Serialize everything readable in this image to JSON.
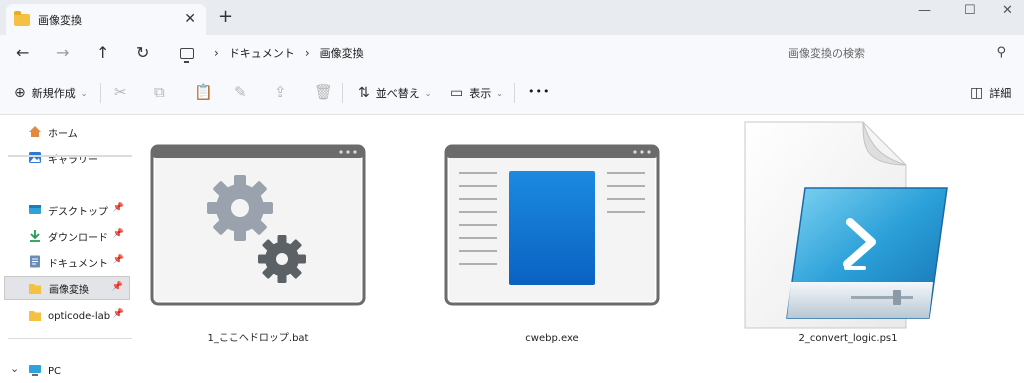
{
  "tab": {
    "title": "画像変換",
    "close": "✕",
    "new": "+"
  },
  "window": {
    "minimize": "—",
    "maximize": "☐",
    "close": "✕"
  },
  "nav": {
    "back": "←",
    "forward": "→",
    "up": "↑",
    "refresh": "↻",
    "breadcrumb": [
      "ドキュメント",
      "画像変換"
    ],
    "separator": "›",
    "search_placeholder": "画像変換の検索"
  },
  "toolbar": {
    "new_label": "新規作成",
    "sort_label": "並べ替え",
    "view_label": "表示",
    "more": "•••",
    "details_label": "詳細"
  },
  "sidebar": {
    "items": [
      {
        "label": "ホーム",
        "icon": "home-icon",
        "pinned": false
      },
      {
        "label": "ギャラリー",
        "icon": "gallery-icon",
        "pinned": false
      },
      {
        "label": "デスクトップ",
        "icon": "desktop-icon",
        "pinned": true
      },
      {
        "label": "ダウンロード",
        "icon": "download-icon",
        "pinned": true
      },
      {
        "label": "ドキュメント",
        "icon": "documents-icon",
        "pinned": true
      },
      {
        "label": "画像変換",
        "icon": "folder-icon",
        "pinned": true,
        "selected": true
      },
      {
        "label": "opticode-lab",
        "icon": "folder-icon",
        "pinned": true
      },
      {
        "label": "PC",
        "icon": "pc-icon",
        "pinned": false
      }
    ],
    "expand_glyph": "⌄"
  },
  "files": [
    {
      "name": "1_ここへドロップ.bat",
      "icon": "batch-file-icon"
    },
    {
      "name": "cwebp.exe",
      "icon": "executable-icon"
    },
    {
      "name": "2_convert_logic.ps1",
      "icon": "powershell-script-icon"
    }
  ],
  "colors": {
    "accent": "#0f6cbd",
    "folder": "#f4c142",
    "chrome": "#e8ebf0",
    "toolbar": "#f7f9fc"
  }
}
